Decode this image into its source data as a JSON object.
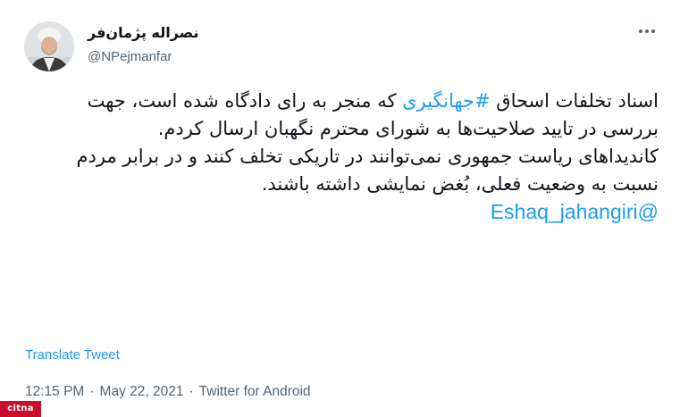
{
  "author": {
    "display_name": "نصراله پژمان‌فر",
    "handle": "@NPejmanfar"
  },
  "tweet": {
    "part1": "اسناد تخلفات اسحاق ",
    "hashtag": "#جهانگیری",
    "part2": " که منجر به رای دادگاه شده است، جهت بررسی در تایید صلاحیت‌ها به شورای محترم نگهبان ارسال کردم.",
    "paragraph2": "کاندیداهای ریاست جمهوری نمی‌توانند در تاریکی تخلف کنند و در برابر مردم نسبت به وضعیت فعلی، بُغض نمایشی داشته باشند.",
    "mention": "@Eshaq_jahangiri"
  },
  "translate_label": "Translate Tweet",
  "meta": {
    "time": "12:15 PM",
    "date": "May 22, 2021",
    "source": "Twitter for Android",
    "separator": "·"
  },
  "watermark": {
    "text": "citna",
    "color": "#c8102e"
  },
  "colors": {
    "link": "#1d9bf0",
    "secondary_text": "#536471",
    "primary_text": "#0f1419"
  },
  "icons": {
    "more": "more-horizontal-icon"
  }
}
